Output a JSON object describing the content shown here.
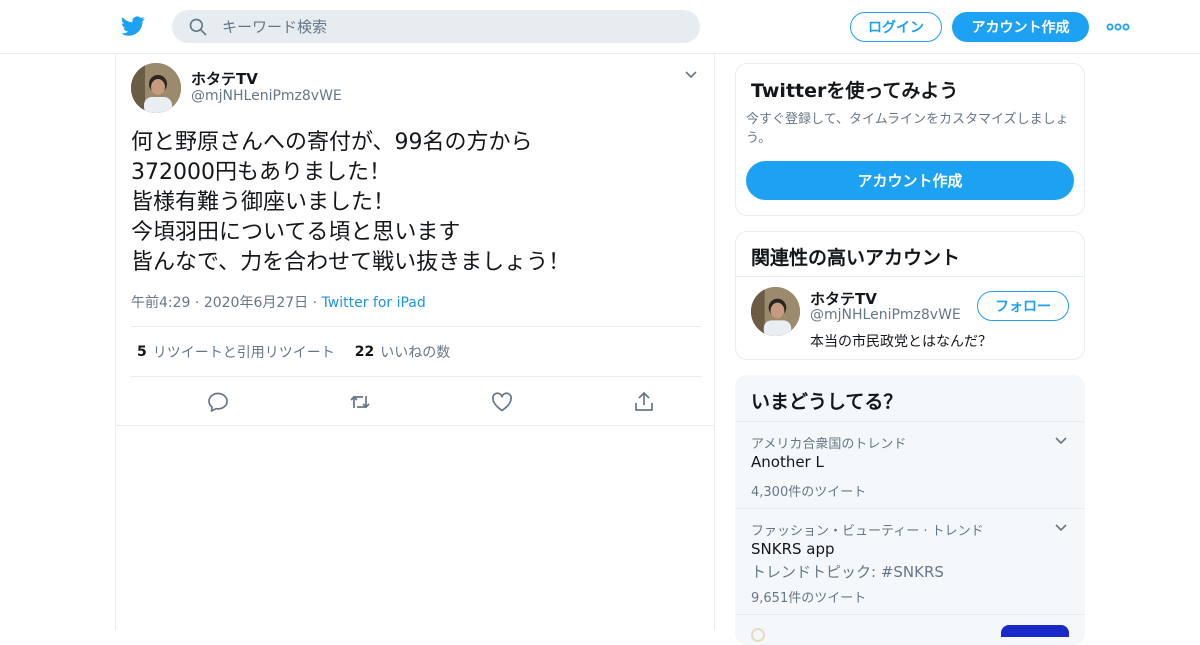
{
  "header": {
    "search_placeholder": "キーワード検索",
    "login_label": "ログイン",
    "signup_label": "アカウント作成",
    "brand_color": "#1da1f2"
  },
  "tweet": {
    "author_name": "ホタテTV",
    "author_handle": "@mjNHLeniPmz8vWE",
    "lines": [
      "何と野原さんへの寄付が、99名の方から",
      "372000円もありました！",
      "皆様有難う御座いました！",
      "今頃羽田についてる頃と思います",
      "皆んなで、力を合わせて戦い抜きましょう！"
    ],
    "time": "午前4:29",
    "date": "2020年6月27日",
    "source": "Twitter for iPad",
    "retweet_count": "5",
    "retweet_label": "リツイートと引用リツイート",
    "like_count": "22",
    "like_label": "いいねの数"
  },
  "signup_card": {
    "title": "Twitterを使ってみよう",
    "description": "今すぐ登録して、タイムラインをカスタマイズしましょう。",
    "button_label": "アカウント作成"
  },
  "related": {
    "title": "関連性の高いアカウント",
    "account": {
      "name": "ホタテTV",
      "handle": "@mjNHLeniPmz8vWE",
      "bio": "本当の市民政党とはなんだ？",
      "follow_label": "フォロー"
    }
  },
  "trends": {
    "title": "いまどうしてる？",
    "items": [
      {
        "context": "アメリカ合衆国のトレンド",
        "name": "Another L",
        "topic": "",
        "count": "4,300件のツイート"
      },
      {
        "context": "ファッション・ビューティー · トレンド",
        "name": "SNKRS app",
        "topic": "トレンドトピック: #SNKRS",
        "count": "9,651件のツイート"
      }
    ]
  },
  "icons": {
    "logo": "twitter-bird-icon",
    "search": "search-icon",
    "more": "more-dots-icon",
    "reply": "reply-icon",
    "retweet": "retweet-icon",
    "like": "heart-icon",
    "share": "share-icon",
    "caret": "chevron-down-icon"
  }
}
